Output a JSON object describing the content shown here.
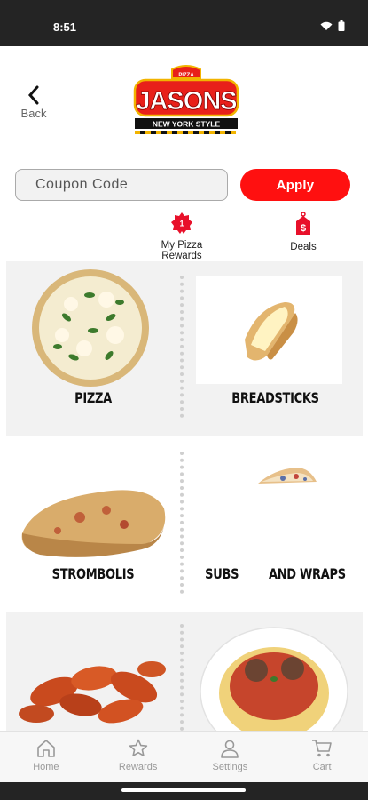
{
  "status_bar": {
    "time": "8:51"
  },
  "header": {
    "back_label": "Back"
  },
  "logo": {
    "top_text": "PIZZA",
    "brand": "JASONS",
    "tagline": "NEW YORK STYLE"
  },
  "coupon": {
    "placeholder": "Coupon Code",
    "apply_label": "Apply"
  },
  "quick_links": [
    {
      "label": "My Pizza Rewards",
      "icon": "reward-badge-icon"
    },
    {
      "label": "Deals",
      "icon": "price-tag-icon"
    }
  ],
  "categories": [
    {
      "label": "PIZZA",
      "icon": "pizza-image"
    },
    {
      "label": "BREADSTICKS",
      "icon": "breadsticks-image"
    },
    {
      "label": "STROMBOLIS",
      "icon": "stromboli-image"
    },
    {
      "label": "SUBS        AND WRAPS",
      "icon": "sub-sandwich-image"
    },
    {
      "label": "",
      "icon": "chicken-wings-image"
    },
    {
      "label": "",
      "icon": "spaghetti-image"
    }
  ],
  "bottom_nav": [
    {
      "label": "Home",
      "icon": "home-icon"
    },
    {
      "label": "Rewards",
      "icon": "star-icon"
    },
    {
      "label": "Settings",
      "icon": "user-icon"
    },
    {
      "label": "Cart",
      "icon": "cart-icon"
    }
  ],
  "colors": {
    "accent": "#ff1010",
    "status_bar": "#242424",
    "tile_bg": "#f2f2f2",
    "nav_inactive": "#999999"
  }
}
